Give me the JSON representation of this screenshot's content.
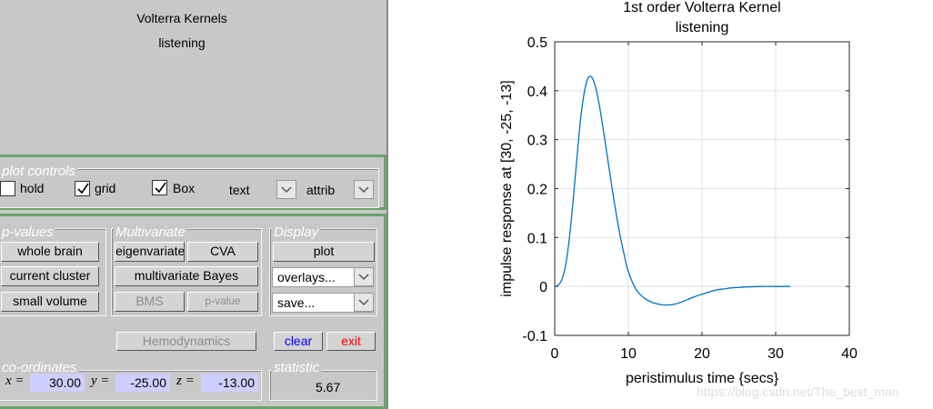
{
  "info": {
    "title": "Volterra Kernels",
    "subtitle": "listening"
  },
  "plot_controls": {
    "legend": "plot controls",
    "hold_label": "hold",
    "hold_checked": false,
    "grid_label": "grid",
    "grid_checked": true,
    "box_label": "Box",
    "box_checked": true,
    "text_label": "text",
    "attrib_label": "attrib"
  },
  "pvalues": {
    "legend": "p-values",
    "whole_brain": "whole brain",
    "current_cluster": "current cluster",
    "small_volume": "small volume"
  },
  "multivariate": {
    "legend": "Multivariate",
    "eigenvariate": "eigenvariate",
    "cva": "CVA",
    "multivariate_bayes": "multivariate Bayes",
    "bms": "BMS",
    "pvalue": "p-value"
  },
  "display": {
    "legend": "Display",
    "plot": "plot",
    "overlays": "overlays...",
    "save": "save..."
  },
  "actions": {
    "hemodynamics": "Hemodynamics",
    "clear": "clear",
    "exit": "exit"
  },
  "colors": {
    "clear": "#0000ff",
    "exit": "#ff0000",
    "panel_border": "#6aa36a",
    "coord_bg": "#cfcfff",
    "curve": "#0072bd"
  },
  "coordinates": {
    "legend": "co-ordinates",
    "x_label": "x =",
    "x": "30.00",
    "y_label": "y =",
    "y": "-25.00",
    "z_label": "z =",
    "z": "-13.00"
  },
  "statistic": {
    "legend": "statistic",
    "value": "5.67"
  },
  "chart_data": {
    "type": "line",
    "title": "1st order Volterra Kernel",
    "subtitle": "listening",
    "xlabel": "peristimulus time {secs}",
    "ylabel": "impulse response at [30, -25, -13]",
    "xlim": [
      0,
      40
    ],
    "ylim": [
      -0.1,
      0.5
    ],
    "xticks": [
      0,
      10,
      20,
      30,
      40
    ],
    "yticks": [
      -0.1,
      0,
      0.1,
      0.2,
      0.3,
      0.4,
      0.5
    ],
    "grid": true,
    "series": [
      {
        "x": [
          0,
          0.5,
          1,
          1.5,
          2,
          2.5,
          3,
          3.5,
          4,
          4.5,
          5,
          5.5,
          6,
          6.5,
          7,
          7.5,
          8,
          8.5,
          9,
          9.5,
          10,
          11,
          12,
          13,
          14,
          15,
          16,
          17,
          18,
          19,
          20,
          21,
          22,
          23,
          24,
          25,
          26,
          28,
          30,
          32
        ],
        "y": [
          0,
          0.003,
          0.015,
          0.045,
          0.1,
          0.175,
          0.26,
          0.34,
          0.395,
          0.425,
          0.428,
          0.41,
          0.375,
          0.33,
          0.28,
          0.23,
          0.18,
          0.135,
          0.095,
          0.06,
          0.03,
          -0.005,
          -0.022,
          -0.031,
          -0.036,
          -0.038,
          -0.037,
          -0.033,
          -0.027,
          -0.021,
          -0.016,
          -0.011,
          -0.007,
          -0.005,
          -0.003,
          -0.002,
          -0.001,
          0,
          0,
          0
        ]
      }
    ]
  }
}
